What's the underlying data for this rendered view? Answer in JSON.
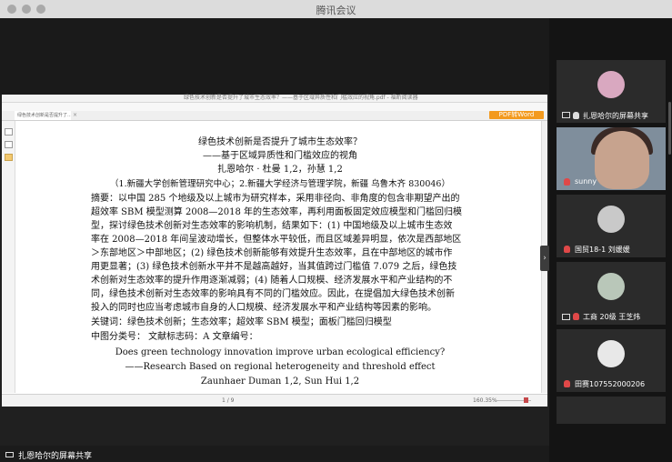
{
  "window": {
    "title": "腾讯会议"
  },
  "viewer": {
    "title": "绿色技术创新是否提升了城市生态效率？——基于区域异质性和门槛效应的视角.pdf - 福昕阅读器",
    "tab": "绿色技术创新是否提升了…",
    "tab_close": "×",
    "pdf_to_word": "PDF转Word",
    "page": "1 / 9",
    "zoom": "160.35%"
  },
  "document": {
    "lines": [
      "绿色技术创新是否提升了城市生态效率？",
      "——基于区域异质性和门槛效应的视角",
      "扎恩哈尔 · 杜曼 1,2，孙慧 1,2",
      "（1.新疆大学创新管理研究中心；2.新疆大学经济与管理学院，新疆 乌鲁木齐 830046）",
      "摘要：以中国 285 个地级及以上城市为研究样本，采用非径向、非角度的包含非期望产出的",
      "超效率 SBM 模型测算 2008—2018 年的生态效率，再利用面板固定效应模型和门槛回归模",
      "型，探讨绿色技术创新对生态效率的影响机制，结果如下：(1) 中国地级及以上城市生态效",
      "率在 2008—2018 年间呈波动增长，但整体水平较低，而且区域差异明显，依次是西部地区",
      "＞东部地区＞中部地区；(2) 绿色技术创新能够有效提升生态效率，且在中部地区的城市作",
      "用更显著；(3) 绿色技术创新水平并不是越高越好，当其值跨过门槛值 7.079 之后，绿色技",
      "术创新对生态效率的提升作用逐渐减弱；(4) 随着人口规模、经济发展水平和产业结构的不",
      "同，绿色技术创新对生态效率的影响具有不同的门槛效应。因此，在提倡加大绿色技术创新",
      "投入的同时也应当考虑城市自身的人口规模、经济发展水平和产业结构等因素的影响。",
      "关键词：绿色技术创新；生态效率；超效率 SBM 模型；面板门槛回归模型",
      "中图分类号：   文献标志码：A   文章编号：",
      "Does green technology innovation improve urban ecological efficiency?",
      "——Research Based on regional heterogeneity and threshold effect",
      "Zaunhaer Duman 1,2,   Sun Hui 1,2"
    ]
  },
  "participants": [
    {
      "name": "扎恩哈尔的屏幕共享",
      "avatar_color": "#d9a8c0"
    },
    {
      "name": "sunny"
    },
    {
      "name": "国贸18-1 刘媛媛",
      "avatar_color": "#c9c9c9"
    },
    {
      "name": "工商 20级 王芝炜",
      "avatar_color": "#b9c7b9"
    },
    {
      "name": "田赛107552000206",
      "avatar_color": "#e8e8e8"
    }
  ],
  "share_label": "扎恩哈尔的屏幕共享",
  "colors": {
    "mic_muted": "#e04848",
    "pdf_word": "#f39a1e"
  }
}
